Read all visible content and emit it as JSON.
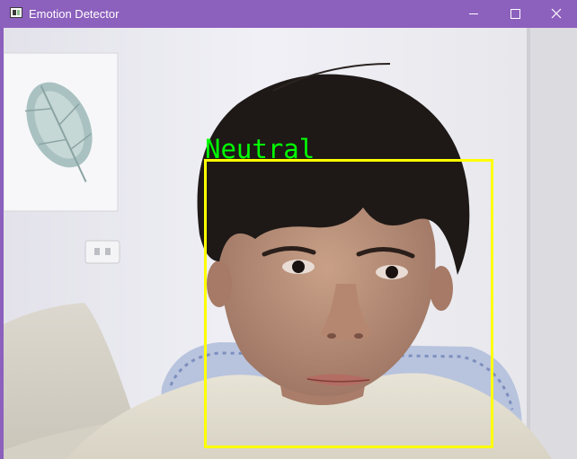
{
  "window": {
    "title": "Emotion Detector",
    "titlebar_color": "#8c60bd",
    "icon": "app-window-icon",
    "controls": {
      "minimize_icon": "minimize-icon",
      "maximize_icon": "maximize-icon",
      "close_icon": "close-icon"
    }
  },
  "detection": {
    "emotion": "Neutral",
    "label_color": "#00ff00",
    "box_color": "#ffff00"
  }
}
